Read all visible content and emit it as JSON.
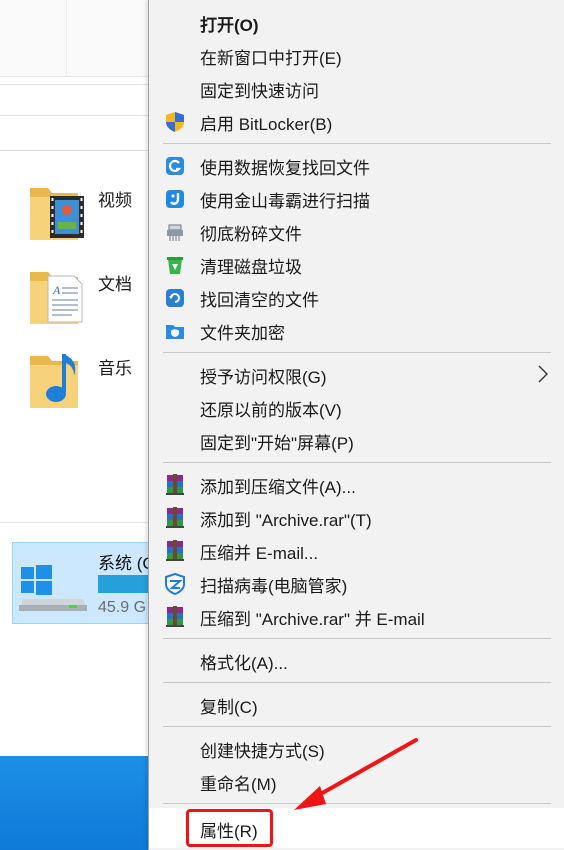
{
  "explorer": {
    "folders": [
      {
        "label": "视频",
        "icon": "video-folder-icon"
      },
      {
        "label": "文档",
        "icon": "documents-folder-icon"
      },
      {
        "label": "音乐",
        "icon": "music-folder-icon"
      }
    ],
    "drive": {
      "label": "系统 (C",
      "free_text": "45.9 G",
      "usage_fraction": 0.85,
      "icon": "windows-drive-icon"
    }
  },
  "menu": {
    "items": [
      {
        "label": "打开(O)",
        "icon": "",
        "bold": true
      },
      {
        "label": "在新窗口中打开(E)",
        "icon": ""
      },
      {
        "label": "固定到快速访问",
        "icon": ""
      },
      {
        "label": "启用 BitLocker(B)",
        "icon": "shield-icon"
      },
      {
        "label": "使用数据恢复找回文件",
        "icon": "data-recovery-icon"
      },
      {
        "label": "使用金山毒霸进行扫描",
        "icon": "kingsoft-scan-icon"
      },
      {
        "label": "彻底粉碎文件",
        "icon": "shredder-icon"
      },
      {
        "label": "清理磁盘垃圾",
        "icon": "disk-clean-icon"
      },
      {
        "label": "找回清空的文件",
        "icon": "restore-icon"
      },
      {
        "label": "文件夹加密",
        "icon": "folder-encrypt-icon"
      },
      {
        "label": "授予访问权限(G)",
        "icon": "",
        "submenu": true
      },
      {
        "label": "还原以前的版本(V)",
        "icon": ""
      },
      {
        "label": "固定到\"开始\"屏幕(P)",
        "icon": ""
      },
      {
        "label": "添加到压缩文件(A)...",
        "icon": "winrar-icon"
      },
      {
        "label": "添加到 \"Archive.rar\"(T)",
        "icon": "winrar-icon"
      },
      {
        "label": "压缩并 E-mail...",
        "icon": "winrar-icon"
      },
      {
        "label": "扫描病毒(电脑管家)",
        "icon": "tencent-guard-icon"
      },
      {
        "label": "压缩到 \"Archive.rar\" 并 E-mail",
        "icon": "winrar-icon"
      },
      {
        "label": "格式化(A)...",
        "icon": ""
      },
      {
        "label": "复制(C)",
        "icon": ""
      },
      {
        "label": "创建快捷方式(S)",
        "icon": ""
      },
      {
        "label": "重命名(M)",
        "icon": ""
      },
      {
        "label": "属性(R)",
        "icon": "",
        "highlighted": true
      }
    ]
  },
  "colors": {
    "menu_bg": "#f2f2f2",
    "highlight_box": "#f01414",
    "taskbar": "#1283de",
    "drive_selected": "#cce8ff",
    "drive_bar": "#26a0da"
  }
}
